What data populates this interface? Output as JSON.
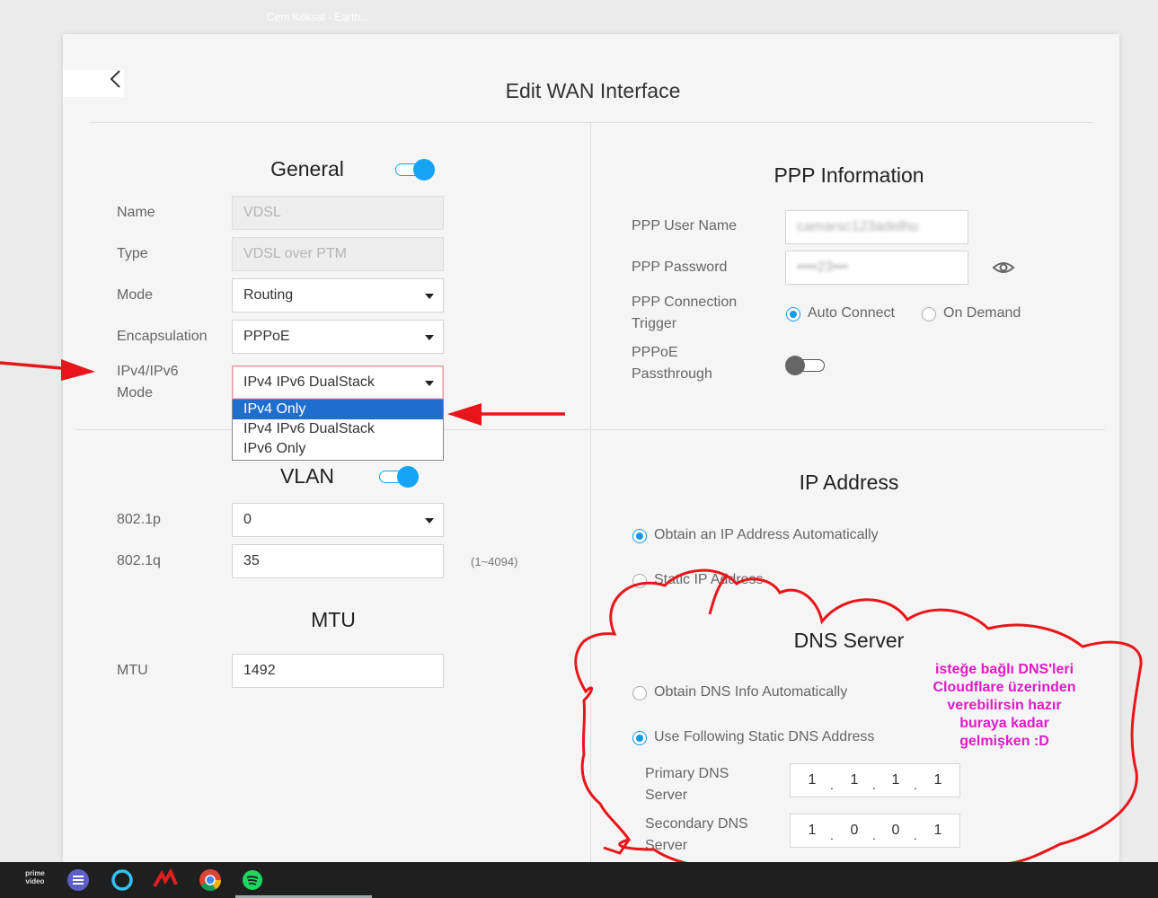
{
  "header": {
    "title": "Edit WAN Interface"
  },
  "general": {
    "title": "General",
    "fields": {
      "name": {
        "label": "Name",
        "value": "VDSL"
      },
      "type": {
        "label": "Type",
        "value": "VDSL over PTM"
      },
      "mode": {
        "label": "Mode",
        "value": "Routing"
      },
      "encapsulation": {
        "label": "Encapsulation",
        "value": "PPPoE"
      },
      "ip_mode": {
        "label_line1": "IPv4/IPv6",
        "label_line2": "Mode",
        "value": "IPv4 IPv6 DualStack"
      }
    },
    "ip_mode_options": [
      "IPv4 Only",
      "IPv4 IPv6 DualStack",
      "IPv6 Only"
    ]
  },
  "vlan": {
    "title": "VLAN",
    "p_label": "802.1p",
    "p_value": "0",
    "q_label": "802.1q",
    "q_value": "35",
    "q_hint": "(1~4094)"
  },
  "mtu": {
    "title": "MTU",
    "label": "MTU",
    "value": "1492"
  },
  "ppp": {
    "title": "PPP Information",
    "user_label": "PPP User Name",
    "user_value": "camarsc123adelhu",
    "pass_label": "PPP Password",
    "pass_value": "••••23•••",
    "trigger_label_line1": "PPP Connection",
    "trigger_label_line2": "Trigger",
    "auto_connect": "Auto Connect",
    "on_demand": "On Demand",
    "passthrough_line1": "PPPoE",
    "passthrough_line2": "Passthrough"
  },
  "ip_address": {
    "title": "IP Address",
    "auto": "Obtain an IP Address Automatically",
    "static": "Static IP Address"
  },
  "dns": {
    "title": "DNS Server",
    "auto": "Obtain DNS Info Automatically",
    "static": "Use Following Static DNS Address",
    "primary_line1": "Primary DNS",
    "primary_line2": "Server",
    "secondary_line1": "Secondary DNS",
    "secondary_line2": "Server",
    "primary": [
      "1",
      "1",
      "1",
      "1"
    ],
    "secondary": [
      "1",
      "0",
      "0",
      "1"
    ]
  },
  "annotation": {
    "lines": [
      "isteğe bağlı DNS'leri",
      "Cloudflare üzerinden",
      "verebilirsin hazır",
      "buraya kadar",
      "gelmişken :D"
    ],
    "color": "#e01ac8",
    "arrow_color": "#e8161b"
  },
  "taskbar": {
    "prime_line1": "prime",
    "prime_line2": "video",
    "spotify_title": "Cem Köksal - Earth..."
  },
  "colors": {
    "accent": "#15a3f5",
    "selection": "#1f6ecf"
  }
}
